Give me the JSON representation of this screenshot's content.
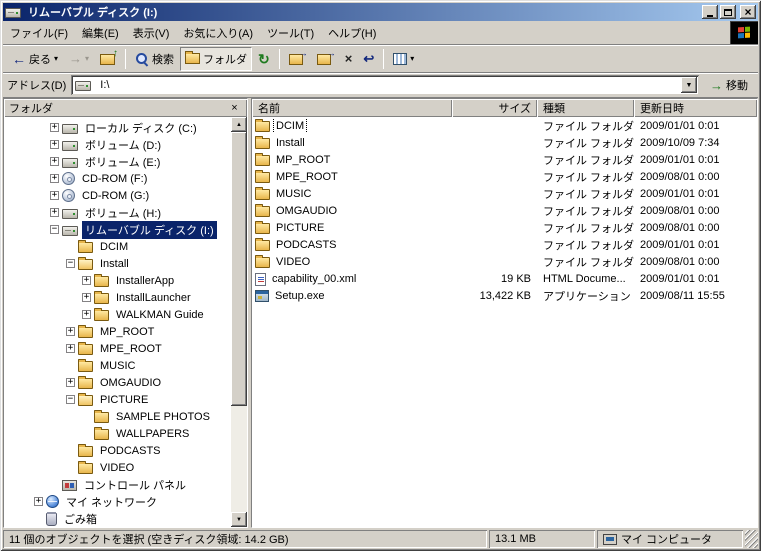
{
  "colors": {
    "titlebar_gradient_start": "#0A246A",
    "titlebar_gradient_end": "#A6CAF0",
    "selection": "#0A246A",
    "chrome": "#D4D0C8"
  },
  "window": {
    "title": "リムーバブル ディスク (I:)"
  },
  "menu": {
    "items": [
      "ファイル(F)",
      "編集(E)",
      "表示(V)",
      "お気に入り(A)",
      "ツール(T)",
      "ヘルプ(H)"
    ]
  },
  "toolbar": {
    "back_label": "戻る",
    "search_label": "検索",
    "folders_label": "フォルダ"
  },
  "addressbar": {
    "label": "アドレス(D)",
    "value": "I:\\",
    "go_label": "移動"
  },
  "folders_panel": {
    "title": "フォルダ",
    "tree": [
      {
        "label": "ローカル ディスク (C:)",
        "level": 2,
        "expander": "+",
        "icon": "drive"
      },
      {
        "label": "ボリューム (D:)",
        "level": 2,
        "expander": "+",
        "icon": "drive"
      },
      {
        "label": "ボリューム (E:)",
        "level": 2,
        "expander": "+",
        "icon": "drive"
      },
      {
        "label": "CD-ROM (F:)",
        "level": 2,
        "expander": "+",
        "icon": "cdrom"
      },
      {
        "label": "CD-ROM (G:)",
        "level": 2,
        "expander": "+",
        "icon": "cdrom"
      },
      {
        "label": "ボリューム (H:)",
        "level": 2,
        "expander": "+",
        "icon": "drive"
      },
      {
        "label": "リムーバブル ディスク (I:)",
        "level": 2,
        "expander": "-",
        "icon": "removable",
        "selected": true
      },
      {
        "label": "DCIM",
        "level": 3,
        "expander": "",
        "icon": "folder"
      },
      {
        "label": "Install",
        "level": 3,
        "expander": "-",
        "icon": "folder-open"
      },
      {
        "label": "InstallerApp",
        "level": 4,
        "expander": "+",
        "icon": "folder"
      },
      {
        "label": "InstallLauncher",
        "level": 4,
        "expander": "+",
        "icon": "folder"
      },
      {
        "label": "WALKMAN Guide",
        "level": 4,
        "expander": "+",
        "icon": "folder"
      },
      {
        "label": "MP_ROOT",
        "level": 3,
        "expander": "+",
        "icon": "folder"
      },
      {
        "label": "MPE_ROOT",
        "level": 3,
        "expander": "+",
        "icon": "folder"
      },
      {
        "label": "MUSIC",
        "level": 3,
        "expander": "",
        "icon": "folder"
      },
      {
        "label": "OMGAUDIO",
        "level": 3,
        "expander": "+",
        "icon": "folder"
      },
      {
        "label": "PICTURE",
        "level": 3,
        "expander": "-",
        "icon": "folder-open"
      },
      {
        "label": "SAMPLE PHOTOS",
        "level": 4,
        "expander": "",
        "icon": "folder"
      },
      {
        "label": "WALLPAPERS",
        "level": 4,
        "expander": "",
        "icon": "folder"
      },
      {
        "label": "PODCASTS",
        "level": 3,
        "expander": "",
        "icon": "folder"
      },
      {
        "label": "VIDEO",
        "level": 3,
        "expander": "",
        "icon": "folder"
      },
      {
        "label": "コントロール パネル",
        "level": 2,
        "expander": "",
        "icon": "control-panel"
      },
      {
        "label": "マイ ネットワーク",
        "level": 1,
        "expander": "+",
        "icon": "network"
      },
      {
        "label": "ごみ箱",
        "level": 1,
        "expander": "",
        "icon": "recycle"
      }
    ]
  },
  "file_list": {
    "columns": [
      {
        "label": "名前",
        "align": "left"
      },
      {
        "label": "サイズ",
        "align": "right"
      },
      {
        "label": "種類",
        "align": "left"
      },
      {
        "label": "更新日時",
        "align": "left"
      }
    ],
    "rows": [
      {
        "name": "DCIM",
        "size": "",
        "type": "ファイル フォルダ",
        "modified": "2009/01/01 0:01",
        "icon": "folder",
        "focused": true
      },
      {
        "name": "Install",
        "size": "",
        "type": "ファイル フォルダ",
        "modified": "2009/10/09 7:34",
        "icon": "folder"
      },
      {
        "name": "MP_ROOT",
        "size": "",
        "type": "ファイル フォルダ",
        "modified": "2009/01/01 0:01",
        "icon": "folder"
      },
      {
        "name": "MPE_ROOT",
        "size": "",
        "type": "ファイル フォルダ",
        "modified": "2009/08/01 0:00",
        "icon": "folder"
      },
      {
        "name": "MUSIC",
        "size": "",
        "type": "ファイル フォルダ",
        "modified": "2009/01/01 0:01",
        "icon": "folder"
      },
      {
        "name": "OMGAUDIO",
        "size": "",
        "type": "ファイル フォルダ",
        "modified": "2009/08/01 0:00",
        "icon": "folder"
      },
      {
        "name": "PICTURE",
        "size": "",
        "type": "ファイル フォルダ",
        "modified": "2009/08/01 0:00",
        "icon": "folder"
      },
      {
        "name": "PODCASTS",
        "size": "",
        "type": "ファイル フォルダ",
        "modified": "2009/01/01 0:01",
        "icon": "folder"
      },
      {
        "name": "VIDEO",
        "size": "",
        "type": "ファイル フォルダ",
        "modified": "2009/08/01 0:00",
        "icon": "folder"
      },
      {
        "name": "capability_00.xml",
        "size": "19 KB",
        "type": "HTML Docume...",
        "modified": "2009/01/01 0:01",
        "icon": "xml-doc"
      },
      {
        "name": "Setup.exe",
        "size": "13,422 KB",
        "type": "アプリケーション",
        "modified": "2009/08/11 15:55",
        "icon": "application"
      }
    ]
  },
  "statusbar": {
    "selection_text": "11 個のオブジェクトを選択 (空きディスク領域: 14.2 GB)",
    "size_text": "13.1 MB",
    "zone_text": "マイ コンピュータ"
  }
}
